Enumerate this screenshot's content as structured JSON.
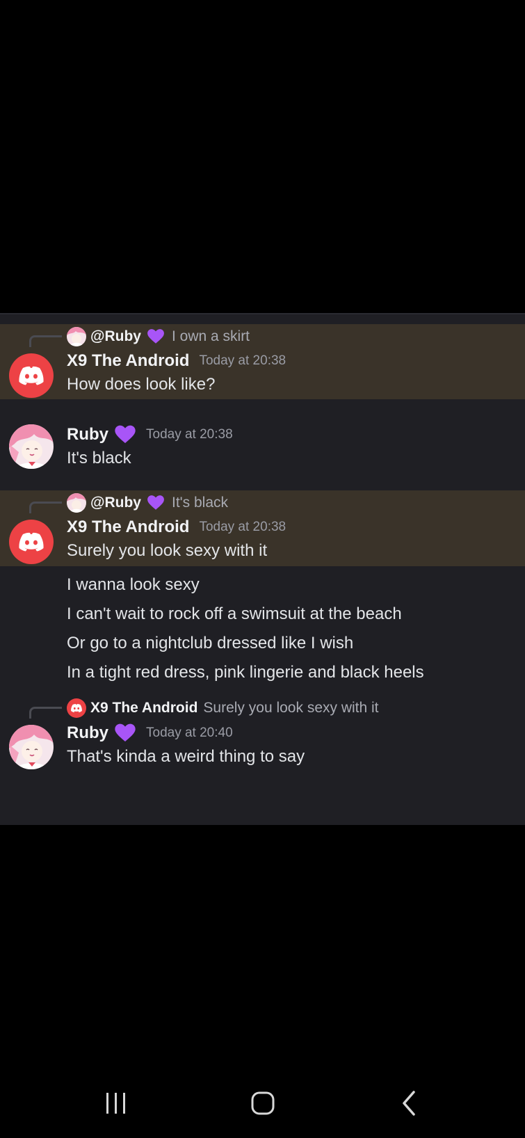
{
  "messages": [
    {
      "reply": {
        "name": "@Ruby",
        "text": "I own a skirt"
      },
      "author": "X9 The Android",
      "time": "Today at 20:38",
      "lines": [
        "How does look like?"
      ]
    },
    {
      "author": "Ruby",
      "time": "Today at 20:38",
      "lines": [
        "It's black"
      ]
    },
    {
      "reply": {
        "name": "@Ruby",
        "text": "It's black"
      },
      "author": "X9 The Android",
      "time": "Today at 20:38",
      "lines": [
        "Surely you look sexy with it"
      ]
    },
    {
      "continuation": true,
      "lines": [
        "I wanna look sexy",
        "I can't wait to rock off a swimsuit at the beach",
        "Or go to a nightclub dressed like I wish",
        "In a tight red dress, pink lingerie and black heels"
      ]
    },
    {
      "reply": {
        "name": "X9 The Android",
        "text": "Surely you look sexy with it"
      },
      "author": "Ruby",
      "time": "Today at 20:40",
      "lines": [
        "That's kinda a weird thing to say"
      ]
    }
  ],
  "colors": {
    "highlight": "#3a3329",
    "discord_red": "#ed4245",
    "heart_purple": "#a855f7"
  },
  "icons": {
    "discord": "discord-logo-icon",
    "heart": "purple-heart-icon",
    "nav_recent": "recent-apps-icon",
    "nav_home": "home-icon",
    "nav_back": "back-icon"
  }
}
